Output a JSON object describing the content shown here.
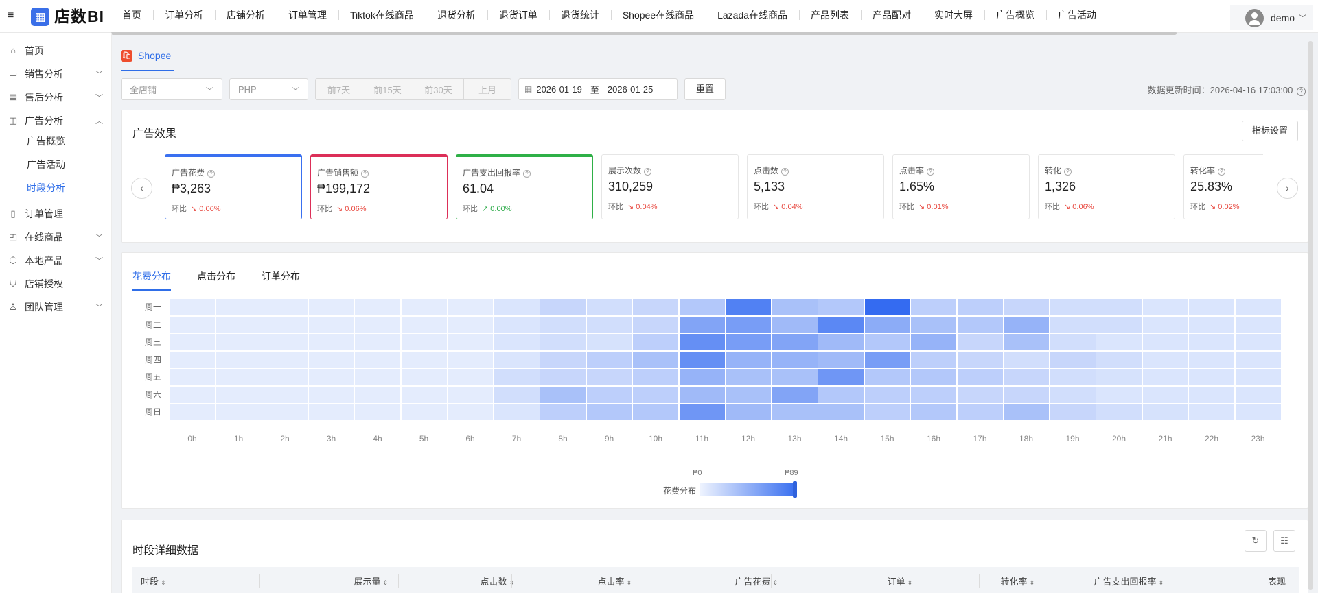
{
  "app": {
    "brand": "店数BI",
    "logo_glyph": "📊"
  },
  "topnav": [
    "首页",
    "订单分析",
    "店铺分析",
    "订单管理",
    "Tiktok在线商品",
    "退货分析",
    "退货订单",
    "退货统计",
    "Shopee在线商品",
    "Lazada在线商品",
    "产品列表",
    "产品配对",
    "实时大屏",
    "广告概览",
    "广告活动"
  ],
  "user": {
    "name": "demo"
  },
  "sidebar": {
    "items": [
      {
        "label": "首页",
        "icon": "home-icon"
      },
      {
        "label": "销售分析",
        "icon": "chart-icon",
        "caret": "down"
      },
      {
        "label": "售后分析",
        "icon": "return-icon",
        "caret": "down"
      },
      {
        "label": "广告分析",
        "icon": "ad-icon",
        "caret": "up"
      },
      {
        "label": "订单管理",
        "icon": "order-icon"
      },
      {
        "label": "在线商品",
        "icon": "bag-icon",
        "caret": "down"
      },
      {
        "label": "本地产品",
        "icon": "box-icon",
        "caret": "down"
      },
      {
        "label": "店铺授权",
        "icon": "shield-icon"
      },
      {
        "label": "团队管理",
        "icon": "team-icon",
        "caret": "down"
      }
    ],
    "sub_items": [
      "广告概览",
      "广告活动",
      "时段分析"
    ],
    "active_sub": "时段分析"
  },
  "platform_tab": {
    "label": "Shopee"
  },
  "filters": {
    "shop": "全店铺",
    "currency": "PHP",
    "quick_ranges": [
      "前7天",
      "前15天",
      "前30天",
      "上月"
    ],
    "start_date": "2026-01-19",
    "date_separator": "至",
    "end_date": "2026-01-25",
    "reset": "重置",
    "update_time": "数据更新时间：2026-04-16 17:03:00"
  },
  "ad_effect": {
    "title": "广告效果",
    "settings_button": "指标设置",
    "compare_label": "环比",
    "kpis": [
      {
        "label": "广告花费",
        "value": "₱3,263",
        "change": "0.06%",
        "trend": "down",
        "accent": "#3a70f0"
      },
      {
        "label": "广告销售额",
        "value": "₱199,172",
        "change": "0.06%",
        "trend": "down",
        "accent": "#dc2f58"
      },
      {
        "label": "广告支出回报率",
        "value": "61.04",
        "change": "0.00%",
        "trend": "up",
        "accent": "#2fb047"
      },
      {
        "label": "展示次数",
        "value": "310,259",
        "change": "0.04%",
        "trend": "down"
      },
      {
        "label": "点击数",
        "value": "5,133",
        "change": "0.04%",
        "trend": "down"
      },
      {
        "label": "点击率",
        "value": "1.65%",
        "change": "0.01%",
        "trend": "down"
      },
      {
        "label": "转化",
        "value": "1,326",
        "change": "0.06%",
        "trend": "down"
      },
      {
        "label": "转化率",
        "value": "25.83%",
        "change": "0.02%",
        "trend": "down"
      }
    ]
  },
  "distribution": {
    "tabs": [
      "花费分布",
      "点击分布",
      "订单分布"
    ],
    "active_tab": "花费分布",
    "days": [
      "周一",
      "周二",
      "周三",
      "周四",
      "周五",
      "周六",
      "周日"
    ],
    "hours": [
      "0h",
      "1h",
      "2h",
      "3h",
      "4h",
      "5h",
      "6h",
      "7h",
      "8h",
      "9h",
      "10h",
      "11h",
      "12h",
      "13h",
      "14h",
      "15h",
      "16h",
      "17h",
      "18h",
      "19h",
      "20h",
      "21h",
      "22h",
      "23h"
    ],
    "intensity": [
      [
        0.05,
        0.05,
        0.05,
        0.05,
        0.05,
        0.05,
        0.05,
        0.1,
        0.2,
        0.15,
        0.2,
        0.3,
        0.8,
        0.35,
        0.3,
        0.95,
        0.25,
        0.25,
        0.2,
        0.15,
        0.15,
        0.1,
        0.1,
        0.1
      ],
      [
        0.05,
        0.05,
        0.05,
        0.05,
        0.05,
        0.05,
        0.05,
        0.1,
        0.15,
        0.15,
        0.2,
        0.55,
        0.6,
        0.4,
        0.75,
        0.5,
        0.35,
        0.3,
        0.45,
        0.15,
        0.15,
        0.1,
        0.1,
        0.1
      ],
      [
        0.05,
        0.05,
        0.05,
        0.05,
        0.05,
        0.05,
        0.05,
        0.1,
        0.15,
        0.12,
        0.25,
        0.7,
        0.6,
        0.55,
        0.4,
        0.3,
        0.45,
        0.2,
        0.35,
        0.15,
        0.1,
        0.1,
        0.1,
        0.1
      ],
      [
        0.05,
        0.05,
        0.05,
        0.05,
        0.05,
        0.05,
        0.05,
        0.1,
        0.2,
        0.25,
        0.35,
        0.7,
        0.45,
        0.45,
        0.4,
        0.6,
        0.25,
        0.2,
        0.15,
        0.2,
        0.15,
        0.1,
        0.1,
        0.1
      ],
      [
        0.05,
        0.05,
        0.05,
        0.05,
        0.05,
        0.05,
        0.05,
        0.15,
        0.2,
        0.2,
        0.25,
        0.45,
        0.35,
        0.35,
        0.65,
        0.3,
        0.3,
        0.25,
        0.2,
        0.15,
        0.12,
        0.1,
        0.1,
        0.1
      ],
      [
        0.05,
        0.05,
        0.05,
        0.05,
        0.05,
        0.05,
        0.05,
        0.15,
        0.35,
        0.25,
        0.25,
        0.4,
        0.35,
        0.55,
        0.3,
        0.25,
        0.25,
        0.2,
        0.2,
        0.15,
        0.1,
        0.1,
        0.1,
        0.1
      ],
      [
        0.05,
        0.05,
        0.05,
        0.05,
        0.05,
        0.05,
        0.05,
        0.1,
        0.25,
        0.3,
        0.3,
        0.65,
        0.4,
        0.35,
        0.35,
        0.25,
        0.3,
        0.25,
        0.35,
        0.2,
        0.15,
        0.12,
        0.1,
        0.1
      ]
    ],
    "legend": {
      "title": "花费分布",
      "min": "₱0",
      "max": "₱89"
    }
  },
  "detail": {
    "title": "时段详细数据",
    "columns": [
      "时段",
      "展示量",
      "点击数",
      "点击率",
      "广告花费",
      "订单",
      "转化率",
      "广告支出回报率",
      "表现"
    ]
  }
}
